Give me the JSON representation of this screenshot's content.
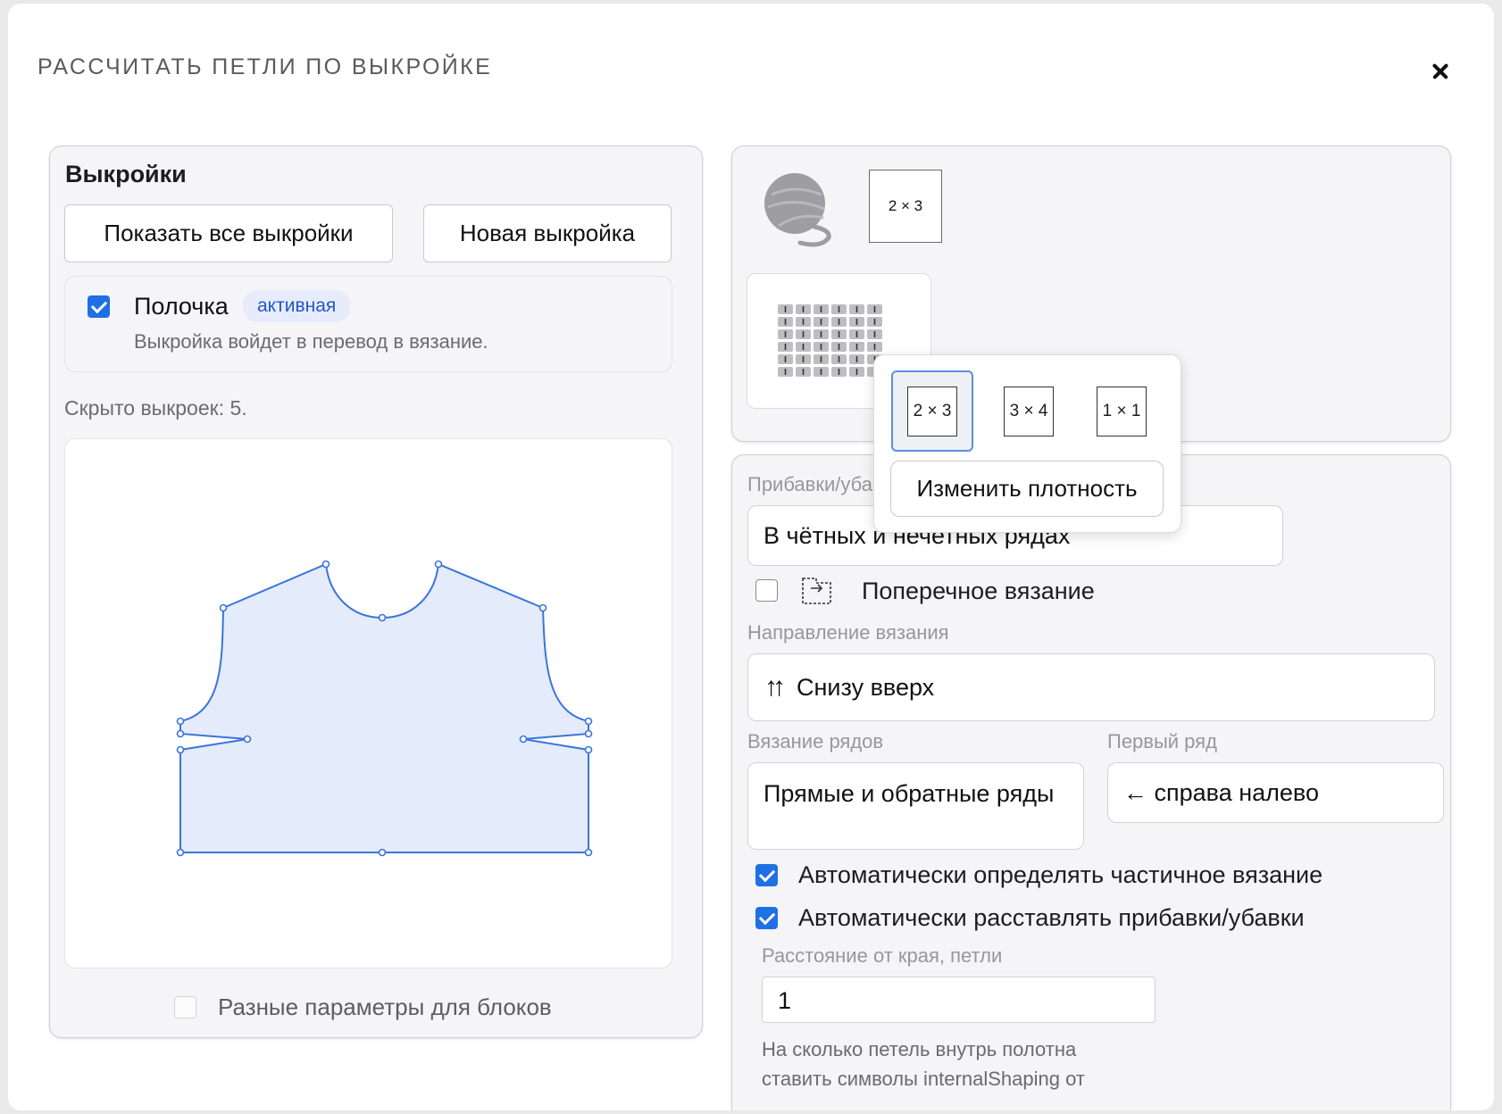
{
  "dialog": {
    "title": "РАССЧИТАТЬ ПЕТЛИ ПО ВЫКРОЙКЕ"
  },
  "patterns": {
    "heading": "Выкройки",
    "show_all_label": "Показать все выкройки",
    "new_label": "Новая выкройка",
    "item": {
      "name": "Полочка",
      "badge": "активная",
      "description": "Выкройка войдет в перевод в вязание.",
      "checked": true
    },
    "hidden_count_text": "Скрыто выкроек: 5.",
    "different_params_label": "Разные параметры для блоков"
  },
  "density": {
    "current": "2 × 3",
    "options": [
      "2 × 3",
      "3 × 4",
      "1 × 1"
    ],
    "selected_index": 0,
    "change_label": "Изменить плотность"
  },
  "settings": {
    "increases_label": "Прибавки/убавки",
    "increases_value": "В чётных и нечетных рядах",
    "transverse_label": "Поперечное вязание",
    "transverse_checked": false,
    "direction_label": "Направление вязания",
    "direction_icon": "arrows-up-icon",
    "direction_value": "Снизу вверх",
    "rows_label": "Вязание рядов",
    "rows_value": "Прямые и обратные ряды",
    "first_row_label": "Первый ряд",
    "first_row_value": "← справа налево",
    "auto_partial_label": "Автоматически определять частичное вязание",
    "auto_partial_checked": true,
    "auto_shaping_label": "Автоматически расставлять прибавки/убавки",
    "auto_shaping_checked": true,
    "edge_distance_label": "Расстояние от края, петли",
    "edge_distance_value": "1",
    "help_line1": "На сколько петель внутрь полотна",
    "help_line2": "ставить символы internalShaping от"
  },
  "colors": {
    "accent": "#1f6fe5",
    "shape_fill": "#e4ebfa",
    "shape_stroke": "#3b74dc",
    "badge_bg": "#e6ecfb",
    "badge_text": "#2457c5"
  }
}
